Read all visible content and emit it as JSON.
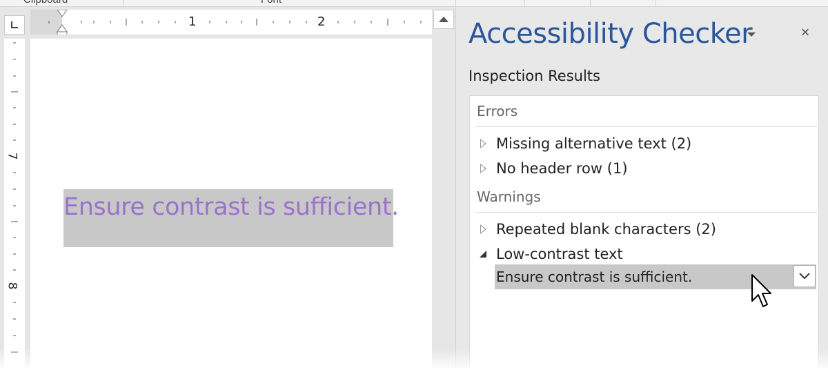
{
  "ribbon": {
    "group_clipboard": "Clipboard",
    "group_font": "Font"
  },
  "ruler": {
    "h_labels": [
      "1",
      "2"
    ],
    "v_labels": [
      "7",
      "8"
    ]
  },
  "document": {
    "selected_text": "Ensure contrast is sufficient.",
    "text_color": "#9b72cc",
    "highlight_color": "#c8c8c8"
  },
  "pane": {
    "title": "Accessibility Checker",
    "title_color": "#2b579a",
    "subtitle": "Inspection Results",
    "close_glyph": "×",
    "sections": [
      {
        "header": "Errors",
        "items": [
          {
            "label": "Missing alternative text (2)",
            "expanded": false
          },
          {
            "label": "No header row (1)",
            "expanded": false
          }
        ]
      },
      {
        "header": "Warnings",
        "items": [
          {
            "label": "Repeated blank characters (2)",
            "expanded": false
          },
          {
            "label": "Low-contrast text",
            "expanded": true,
            "children": [
              "Ensure contrast is sufficient."
            ]
          }
        ]
      }
    ]
  }
}
